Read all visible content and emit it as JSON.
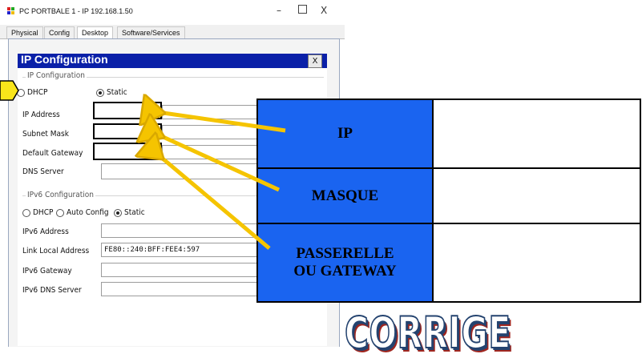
{
  "window": {
    "title": "PC PORTBALE 1 - IP 192.168.1.50",
    "minimize": "–",
    "close": "X",
    "tabs": [
      "Physical",
      "Config",
      "Desktop",
      "Software/Services"
    ],
    "active_tab": "Desktop"
  },
  "panel": {
    "title": "IP Configuration",
    "close_label": "X",
    "ipv4_section": "IP Configuration",
    "dhcp_label": "DHCP",
    "static_label": "Static",
    "mode_selected": "Static",
    "fields": {
      "ip_address": {
        "label": "IP Address",
        "value": ""
      },
      "subnet_mask": {
        "label": "Subnet Mask",
        "value": ""
      },
      "default_gateway": {
        "label": "Default Gateway",
        "value": ""
      },
      "dns_server": {
        "label": "DNS Server",
        "value": ""
      }
    },
    "ipv6_section": "IPv6 Configuration",
    "ipv6_dhcp": "DHCP",
    "ipv6_auto": "Auto Config",
    "ipv6_static": "Static",
    "ipv6_mode_selected": "Static",
    "ipv6_fields": {
      "address": {
        "label": "IPv6 Address",
        "value": ""
      },
      "link_local": {
        "label": "Link Local Address",
        "value": "FE80::240:BFF:FEE4:597"
      },
      "gateway": {
        "label": "IPv6 Gateway",
        "value": ""
      },
      "dns": {
        "label": "IPv6 DNS Server",
        "value": ""
      }
    }
  },
  "callouts": {
    "rows": [
      {
        "label": "IP",
        "answer": ""
      },
      {
        "label": "MASQUE",
        "answer": ""
      },
      {
        "label_line1": "PASSERELLE",
        "label_line2": "OU GATEWAY",
        "answer": ""
      }
    ],
    "label_color": "#1a64f0",
    "arrow_color": "#f5c400"
  },
  "stamp": {
    "text": "CORRIGE"
  }
}
